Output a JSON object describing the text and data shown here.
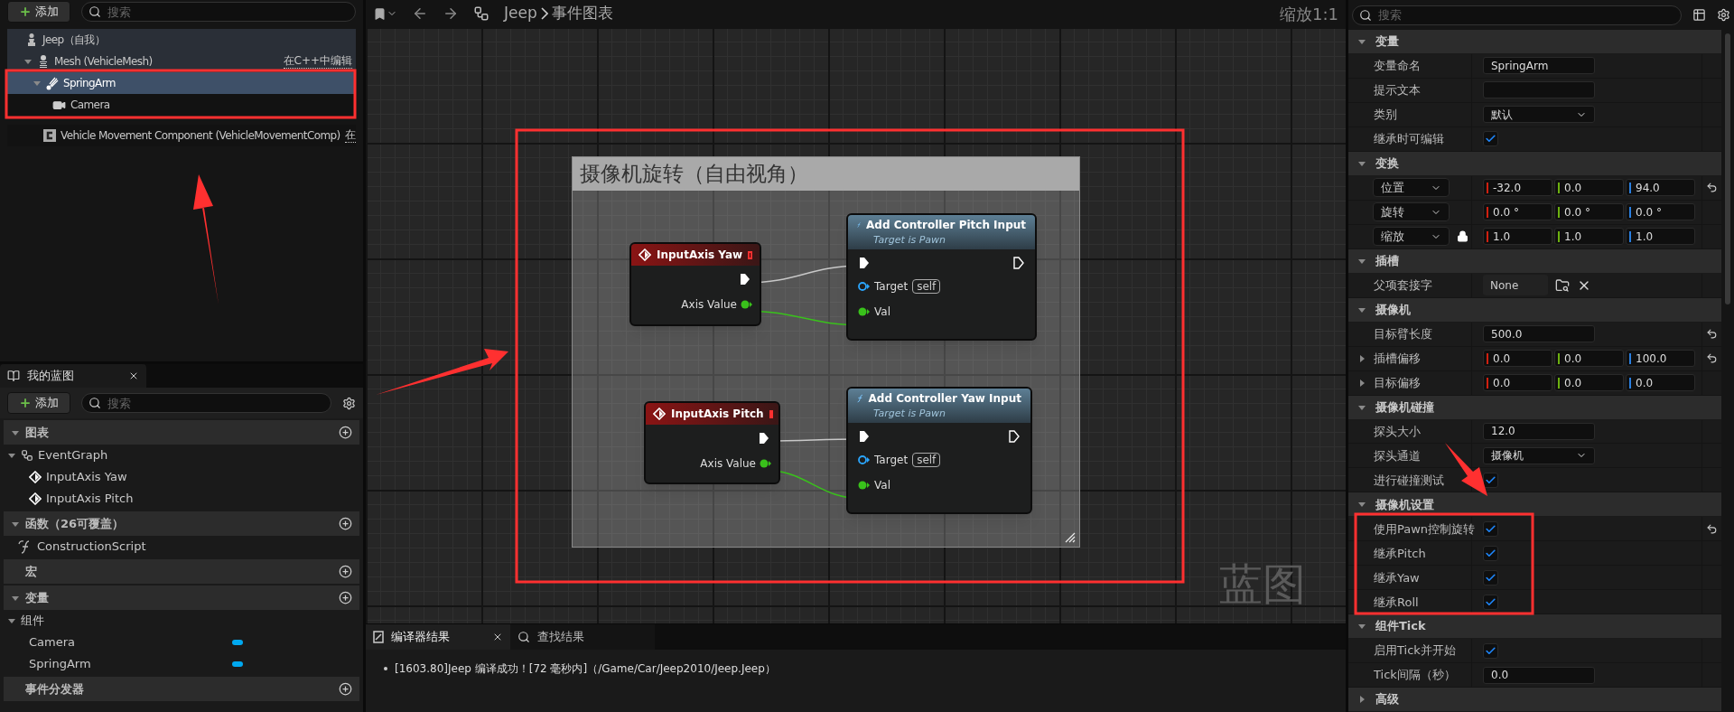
{
  "left_panel": {
    "add_button": "添加",
    "search_placeholder": "搜索",
    "components": [
      {
        "label": "Jeep（自我）",
        "kind": "pawn",
        "selected": false,
        "children": [
          {
            "label": "Mesh (VehicleMesh)",
            "kind": "skeleton",
            "note": "在C++中编辑",
            "expanded": true,
            "selected": false,
            "children": [
              {
                "label": "SpringArm",
                "kind": "spring",
                "expanded": true,
                "selected": true,
                "children": [
                  {
                    "label": "Camera",
                    "kind": "camera",
                    "selected": false
                  }
                ]
              }
            ]
          }
        ]
      },
      {
        "label": "Vehicle Movement Component (VehicleMovementComp)",
        "kind": "component",
        "note": "在",
        "selected": false
      }
    ]
  },
  "my_blueprint": {
    "tab": "我的蓝图",
    "add_button": "添加",
    "search_placeholder": "搜索",
    "sections": [
      {
        "label": "图表",
        "expanded": true,
        "items": [
          {
            "label": "EventGraph",
            "kind": "graph",
            "expanded": true,
            "children": [
              {
                "label": "InputAxis Yaw",
                "kind": "event"
              },
              {
                "label": "InputAxis Pitch",
                "kind": "event"
              }
            ]
          }
        ]
      },
      {
        "label": "函数（26可覆盖）",
        "expanded": true,
        "items": [
          {
            "label": "ConstructionScript",
            "kind": "function"
          }
        ]
      },
      {
        "label": "宏"
      },
      {
        "label": "变量",
        "expanded": true,
        "items": [
          {
            "label": "组件",
            "kind": "folder",
            "expanded": true,
            "children": [
              {
                "label": "Camera",
                "kind": "variable"
              },
              {
                "label": "SpringArm",
                "kind": "variable"
              }
            ]
          }
        ]
      },
      {
        "label": "事件分发器"
      }
    ]
  },
  "graph": {
    "breadcrumb": [
      "Jeep",
      "事件图表"
    ],
    "zoom": "缩放1:1",
    "watermark": "蓝图",
    "comment": "摄像机旋转（自由视角）",
    "nodes": [
      {
        "kind": "event",
        "title": "InputAxis Yaw",
        "output": "Axis Value"
      },
      {
        "kind": "event",
        "title": "InputAxis Pitch",
        "output": "Axis Value"
      },
      {
        "kind": "function",
        "title": "Add Controller Pitch Input",
        "subtitle": "Target is Pawn",
        "target": "Target",
        "target_value": "self",
        "value": "Val"
      },
      {
        "kind": "function",
        "title": "Add Controller Yaw Input",
        "subtitle": "Target is Pawn",
        "target": "Target",
        "target_value": "self",
        "value": "Val"
      }
    ]
  },
  "output": {
    "tabs": [
      {
        "label": "编译器结果",
        "selected": true
      },
      {
        "label": "查找结果",
        "selected": false
      }
    ],
    "log": [
      "[1603.80]Jeep 编译成功！[72 毫秒内]（/Game/Car/Jeep2010/Jeep.Jeep）"
    ]
  },
  "details": {
    "search_placeholder": "搜索",
    "rows": [
      {
        "kind": "header",
        "label": "变量",
        "expanded": true
      },
      {
        "kind": "text",
        "label": "变量命名",
        "value": "SpringArm"
      },
      {
        "kind": "text",
        "label": "提示文本"
      },
      {
        "kind": "dropdown",
        "label": "类别",
        "value": "默认"
      },
      {
        "kind": "check",
        "label": "继承时可编辑",
        "checked": true
      },
      {
        "kind": "header",
        "label": "变换",
        "expanded": true
      },
      {
        "kind": "vector",
        "select": "位置",
        "values": [
          "-32.0",
          "0.0",
          "94.0"
        ],
        "reset": true
      },
      {
        "kind": "vector",
        "select": "旋转",
        "values": [
          "0.0 °",
          "0.0 °",
          "0.0 °"
        ]
      },
      {
        "kind": "vector",
        "select": "缩放",
        "lock": true,
        "values": [
          "1.0",
          "1.0",
          "1.0"
        ]
      },
      {
        "kind": "header",
        "label": "插槽",
        "expanded": true
      },
      {
        "kind": "socket",
        "label": "父项套接字",
        "value": "None"
      },
      {
        "kind": "header",
        "label": "摄像机",
        "expanded": true
      },
      {
        "kind": "text",
        "label": "目标臂长度",
        "value": "500.0",
        "reset": true
      },
      {
        "kind": "vector",
        "label": "插槽偏移",
        "expanded": false,
        "values": [
          "0.0",
          "0.0",
          "100.0"
        ],
        "reset": true
      },
      {
        "kind": "vector",
        "label": "目标偏移",
        "expanded": false,
        "values": [
          "0.0",
          "0.0",
          "0.0"
        ]
      },
      {
        "kind": "header",
        "label": "摄像机碰撞",
        "expanded": true
      },
      {
        "kind": "text",
        "label": "探头大小",
        "value": "12.0"
      },
      {
        "kind": "dropdown",
        "label": "探头通道",
        "value": "摄像机"
      },
      {
        "kind": "check",
        "label": "进行碰撞测试",
        "checked": true
      },
      {
        "kind": "header",
        "label": "摄像机设置",
        "expanded": true
      },
      {
        "kind": "check",
        "label": "使用Pawn控制旋转",
        "checked": true,
        "reset": true
      },
      {
        "kind": "check",
        "label": "继承Pitch",
        "checked": true
      },
      {
        "kind": "check",
        "label": "继承Yaw",
        "checked": true
      },
      {
        "kind": "check",
        "label": "继承Roll",
        "checked": true
      },
      {
        "kind": "header",
        "label": "组件Tick",
        "expanded": true
      },
      {
        "kind": "check",
        "label": "启用Tick并开始",
        "checked": true
      },
      {
        "kind": "text",
        "label": "Tick间隔（秒）",
        "value": "0.0"
      },
      {
        "kind": "header",
        "label": "高级",
        "expanded": false
      }
    ]
  }
}
